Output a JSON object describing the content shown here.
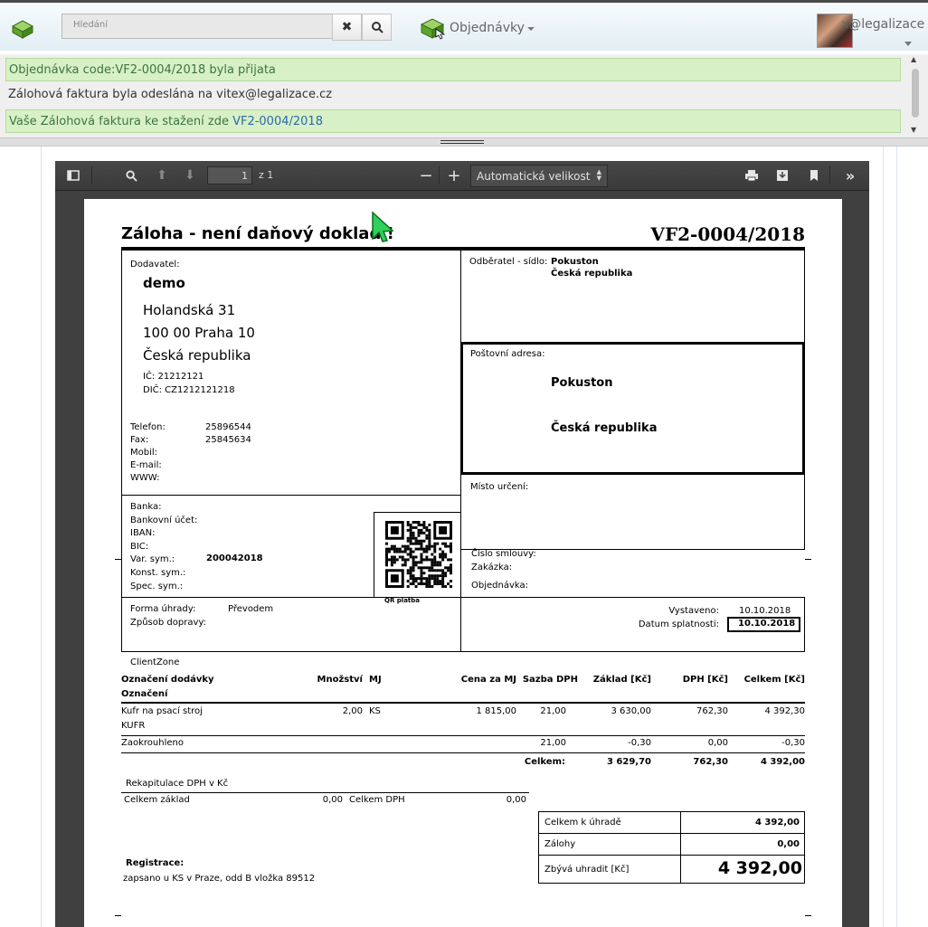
{
  "nav": {
    "search_placeholder": "Hledání",
    "clear_icon": "x-icon",
    "search_icon": "search-icon",
    "orders_label": "Objednávky",
    "user_label": "x@legalizace"
  },
  "messages": [
    {
      "type": "success",
      "text": "Objednávka code:VF2-0004/2018 byla přijata"
    },
    {
      "type": "plain",
      "text": "Zálohová faktura byla odeslána na vitex@legalizace.cz"
    },
    {
      "type": "success",
      "text": "Vaše Zálohová faktura ke stažení zde ",
      "link": "VF2-0004/2018"
    }
  ],
  "viewer": {
    "page_number": "1",
    "page_of": "z 1",
    "zoom": "Automatická velikost"
  },
  "invoice": {
    "title": "Záloha - není daňový doklad !",
    "number": "VF2-0004/2018",
    "supplier_label": "Dodavatel:",
    "supplier_name": "demo",
    "supplier_street": "Holandská 31",
    "supplier_city": "100 00  Praha 10",
    "supplier_country": "Česká republika",
    "ic": "IČ: 21212121",
    "dic": "DIČ: CZ1212121218",
    "contacts": [
      {
        "label": "Telefon:",
        "value": "25896544"
      },
      {
        "label": "Fax:",
        "value": "25845634"
      },
      {
        "label": "Mobil:",
        "value": ""
      },
      {
        "label": "E-mail:",
        "value": ""
      },
      {
        "label": "WWW:",
        "value": ""
      }
    ],
    "customer_label": "Odběratel - sídlo:",
    "customer_name": "Pokuston",
    "customer_country": "Česká republika",
    "postal_label": "Poštovní adresa:",
    "postal_name": "Pokuston",
    "postal_country": "Česká republika",
    "destination_label": "Místo určení:",
    "bank_rows": [
      {
        "label": "Banka:",
        "value": ""
      },
      {
        "label": "Bankovní účet:",
        "value": ""
      },
      {
        "label": "IBAN:",
        "value": ""
      },
      {
        "label": "BIC:",
        "value": ""
      },
      {
        "label": "Var. sym.:",
        "value": "200042018"
      },
      {
        "label": "Konst. sym.:",
        "value": ""
      },
      {
        "label": "Spec. sym.:",
        "value": ""
      }
    ],
    "qr_label": "QR platba",
    "contract_label": "Číslo smlouvy:",
    "job_label": "Zakázka:",
    "order_label": "Objednávka:",
    "payment_method_label": "Forma úhrady:",
    "payment_method": "Převodem",
    "delivery_label": "Způsob dopravy:",
    "issued_label": "Vystaveno:",
    "issued": "10.10.2018",
    "due_label": "Datum splatnosti:",
    "due": "10.10.2018",
    "client_zone": "ClientZone",
    "table_headers": {
      "item": "Označení dodávky",
      "item2": "Označení",
      "qty": "Množství",
      "unit": "MJ",
      "price": "Cena za MJ",
      "vat_rate": "Sazba DPH",
      "base": "Základ [Kč]",
      "vat": "DPH [Kč]",
      "total": "Celkem [Kč]"
    },
    "rows": [
      {
        "name": "Kufr na psací stroj",
        "name2": "KUFR",
        "qty": "2,00",
        "unit": "KS",
        "price": "1 815,00",
        "rate": "21,00",
        "base": "3 630,00",
        "vat": "762,30",
        "total": "4 392,30"
      },
      {
        "name": "Zaokrouhleno",
        "name2": "",
        "qty": "",
        "unit": "",
        "price": "",
        "rate": "21,00",
        "base": "-0,30",
        "vat": "0,00",
        "total": "-0,30"
      }
    ],
    "sum_label": "Celkem:",
    "sum_base": "3 629,70",
    "sum_vat": "762,30",
    "sum_total": "4 392,00",
    "recap_title": "Rekapitulace DPH v Kč",
    "recap_base_label": "Celkem základ",
    "recap_base": "0,00",
    "recap_vat_label": "Celkem DPH",
    "recap_vat": "0,00",
    "totals": [
      {
        "label": "Celkem k úhradě",
        "value": "4 392,00"
      },
      {
        "label": "Zálohy",
        "value": "0,00"
      },
      {
        "label": "Zbývá uhradit [Kč]",
        "value": "4 392,00"
      }
    ],
    "registration_label": "Registrace:",
    "registration": "zapsano u KS v Praze, odd B vložka 89512"
  },
  "colors": {
    "success_bg": "#d8f0c6",
    "success_text": "#3c763d",
    "link": "#2a6aa8",
    "viewer_bg": "#404040"
  }
}
